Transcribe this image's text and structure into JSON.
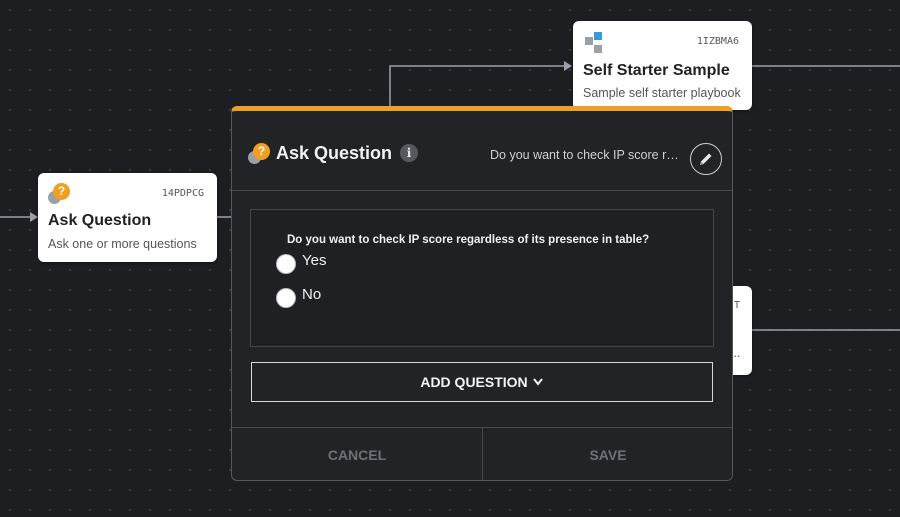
{
  "canvas": {
    "background": "#1c1e22",
    "connector_color": "#9aa0a8"
  },
  "nodes": {
    "ask_question": {
      "id": "14PDPCG",
      "title": "Ask Question",
      "description": "Ask one or more questions",
      "icon": "question-icon"
    },
    "self_starter": {
      "id": "1IZBMA6",
      "title": "Self Starter Sample",
      "description": "Sample self starter playbook",
      "icon": "workflow-icon"
    },
    "partial_node": {
      "id_fragment": "T",
      "description_fragment": "..."
    }
  },
  "modal": {
    "accent_color": "#f0a020",
    "title": "Ask Question",
    "info_icon": "i",
    "header_question": "Do you want to check IP score regardless of its presence in table?",
    "question": {
      "text": "Do you want to check IP score regardless of its presence in table?",
      "options": [
        "Yes",
        "No"
      ]
    },
    "add_question_label": "ADD QUESTION",
    "cancel_label": "CANCEL",
    "save_label": "SAVE"
  }
}
